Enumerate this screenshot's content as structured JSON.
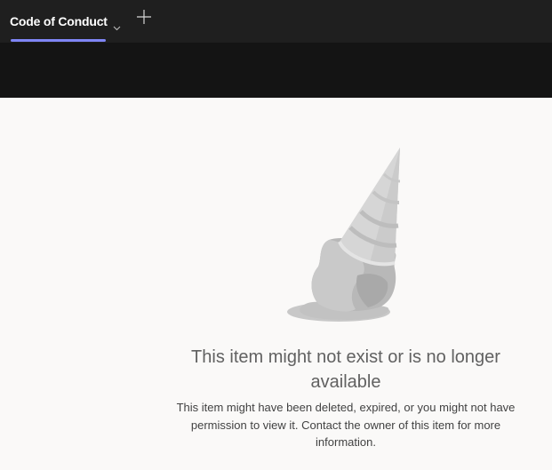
{
  "tabs": [
    {
      "label": "Code of Conduct",
      "active": true
    }
  ],
  "add_tab_icon": "plus-icon",
  "accent_color": "#7f85f5",
  "empty_state": {
    "illustration": "dropped-ice-cream-cone",
    "title": "This item might not exist or is no longer available",
    "description": "This item might have been deleted, expired, or you might not have permission to view it. Contact the owner of this item for more information."
  }
}
